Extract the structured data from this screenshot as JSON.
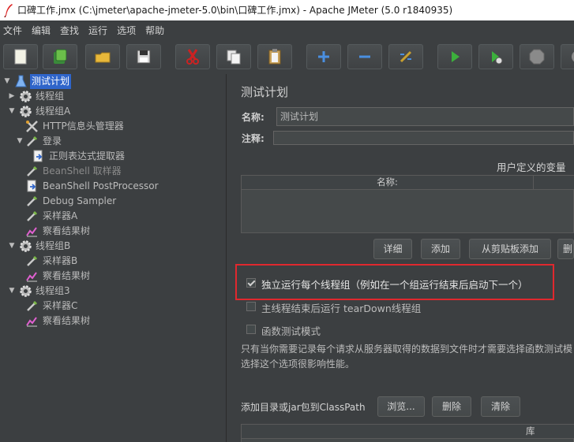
{
  "window": {
    "title": "口碑工作.jmx (C:\\jmeter\\apache-jmeter-5.0\\bin\\口碑工作.jmx) - Apache JMeter (5.0 r1840935)"
  },
  "menu": [
    "文件",
    "编辑",
    "查找",
    "运行",
    "选项",
    "帮助"
  ],
  "toolbar": [
    {
      "name": "new-icon"
    },
    {
      "name": "templates-icon"
    },
    {
      "name": "open-icon"
    },
    {
      "name": "save-icon"
    },
    {
      "name": "cut-icon"
    },
    {
      "name": "copy-icon"
    },
    {
      "name": "paste-icon"
    },
    {
      "name": "expand-icon"
    },
    {
      "name": "collapse-icon"
    },
    {
      "name": "toggle-icon"
    },
    {
      "name": "start-icon"
    },
    {
      "name": "start-no-timers-icon"
    },
    {
      "name": "stop-icon"
    },
    {
      "name": "shutdown-icon"
    }
  ],
  "tree": [
    {
      "label": "测试计划",
      "icon": "flask-icon",
      "selected": true,
      "disabled": false,
      "expanded": "down"
    },
    {
      "label": "线程组",
      "icon": "gear-icon",
      "selected": false,
      "disabled": false,
      "expanded": "right"
    },
    {
      "label": "线程组A",
      "icon": "gear-icon",
      "selected": false,
      "disabled": false,
      "expanded": "down"
    },
    {
      "label": "HTTP信息头管理器",
      "icon": "tools-icon",
      "selected": false,
      "disabled": false,
      "expanded": ""
    },
    {
      "label": "登录",
      "icon": "pipette-icon",
      "selected": false,
      "disabled": false,
      "expanded": "down"
    },
    {
      "label": "正则表达式提取器",
      "icon": "doc-arrow-icon",
      "selected": false,
      "disabled": false,
      "expanded": ""
    },
    {
      "label": "BeanShell 取样器",
      "icon": "pipette-icon",
      "selected": false,
      "disabled": true,
      "expanded": ""
    },
    {
      "label": "BeanShell PostProcessor",
      "icon": "doc-arrow-icon",
      "selected": false,
      "disabled": false,
      "expanded": ""
    },
    {
      "label": "Debug Sampler",
      "icon": "pipette-icon",
      "selected": false,
      "disabled": false,
      "expanded": ""
    },
    {
      "label": "采样器A",
      "icon": "pipette-icon",
      "selected": false,
      "disabled": false,
      "expanded": ""
    },
    {
      "label": "察看结果树",
      "icon": "chart-icon",
      "selected": false,
      "disabled": false,
      "expanded": ""
    },
    {
      "label": "线程组B",
      "icon": "gear-icon",
      "selected": false,
      "disabled": false,
      "expanded": "down"
    },
    {
      "label": "采样器B",
      "icon": "pipette-icon",
      "selected": false,
      "disabled": false,
      "expanded": ""
    },
    {
      "label": "察看结果树",
      "icon": "chart-icon",
      "selected": false,
      "disabled": false,
      "expanded": ""
    },
    {
      "label": "线程组3",
      "icon": "gear-icon",
      "selected": false,
      "disabled": false,
      "expanded": "down"
    },
    {
      "label": "采样器C",
      "icon": "pipette-icon",
      "selected": false,
      "disabled": false,
      "expanded": ""
    },
    {
      "label": "察看结果树",
      "icon": "chart-icon",
      "selected": false,
      "disabled": false,
      "expanded": ""
    }
  ],
  "panel": {
    "title": "测试计划",
    "name_label": "名称:",
    "name_value": "测试计划",
    "comment_label": "注释:",
    "comment_value": "",
    "udv_title": "用户定义的变量",
    "udv_col_name": "名称:",
    "btn_detail": "详细",
    "btn_add": "添加",
    "btn_add_clip": "从剪贴板添加",
    "btn_delete_partial": "删",
    "cb_serial": "独立运行每个线程组（例如在一个组运行结束后启动下一个）",
    "cb_serial_checked": true,
    "cb_teardown": "主线程结束后运行 tearDown线程组",
    "cb_teardown_checked": false,
    "cb_functional": "函数测试模式",
    "cb_functional_checked": false,
    "help_line1": "只有当你需要记录每个请求从服务器取得的数据到文件时才需要选择函数测试模",
    "help_line2": "选择这个选项很影响性能。",
    "classpath_label": "添加目录或jar包到ClassPath",
    "btn_browse": "浏览...",
    "btn_remove": "删除",
    "btn_clear": "清除",
    "lib_col": "库"
  }
}
